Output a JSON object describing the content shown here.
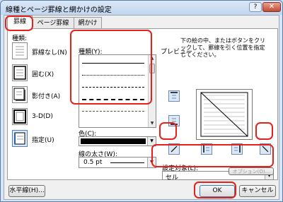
{
  "window": {
    "title": "線種とページ罫線と網かけの設定",
    "help": "?",
    "close": "✕"
  },
  "tabs": [
    "罫線",
    "ページ罫線",
    "網かけ"
  ],
  "settings": {
    "heading": "種類:",
    "items": [
      {
        "label": "罫線なし(N)",
        "icon": "no-border-icon"
      },
      {
        "label": "囲む(X)",
        "icon": "box-border-icon"
      },
      {
        "label": "影付き(A)",
        "icon": "shadow-border-icon"
      },
      {
        "label": "3-D(D)",
        "icon": "3d-border-icon"
      },
      {
        "label": "指定(U)",
        "icon": "custom-border-icon"
      }
    ]
  },
  "style": {
    "heading": "種類(Y):",
    "line_styles": [
      "solid",
      "dotted",
      "dashed-fine",
      "dashed",
      "dash-dot"
    ],
    "color_label": "色(C):",
    "color_value": "#000000",
    "width_label": "線の太さ(W):",
    "width_value": "0.5 pt"
  },
  "preview": {
    "heading": "プレビュー",
    "instructions": "下の絵の中、またはボタンをクリックして、罫線を引く位置を指定してください。"
  },
  "apply_to": {
    "label": "設定対象(L):",
    "value": "セル"
  },
  "options_button": "オプション(O)...",
  "footer": {
    "horizontal_line": "水平線(H)...",
    "ok": "OK",
    "cancel": "キャンセル"
  }
}
